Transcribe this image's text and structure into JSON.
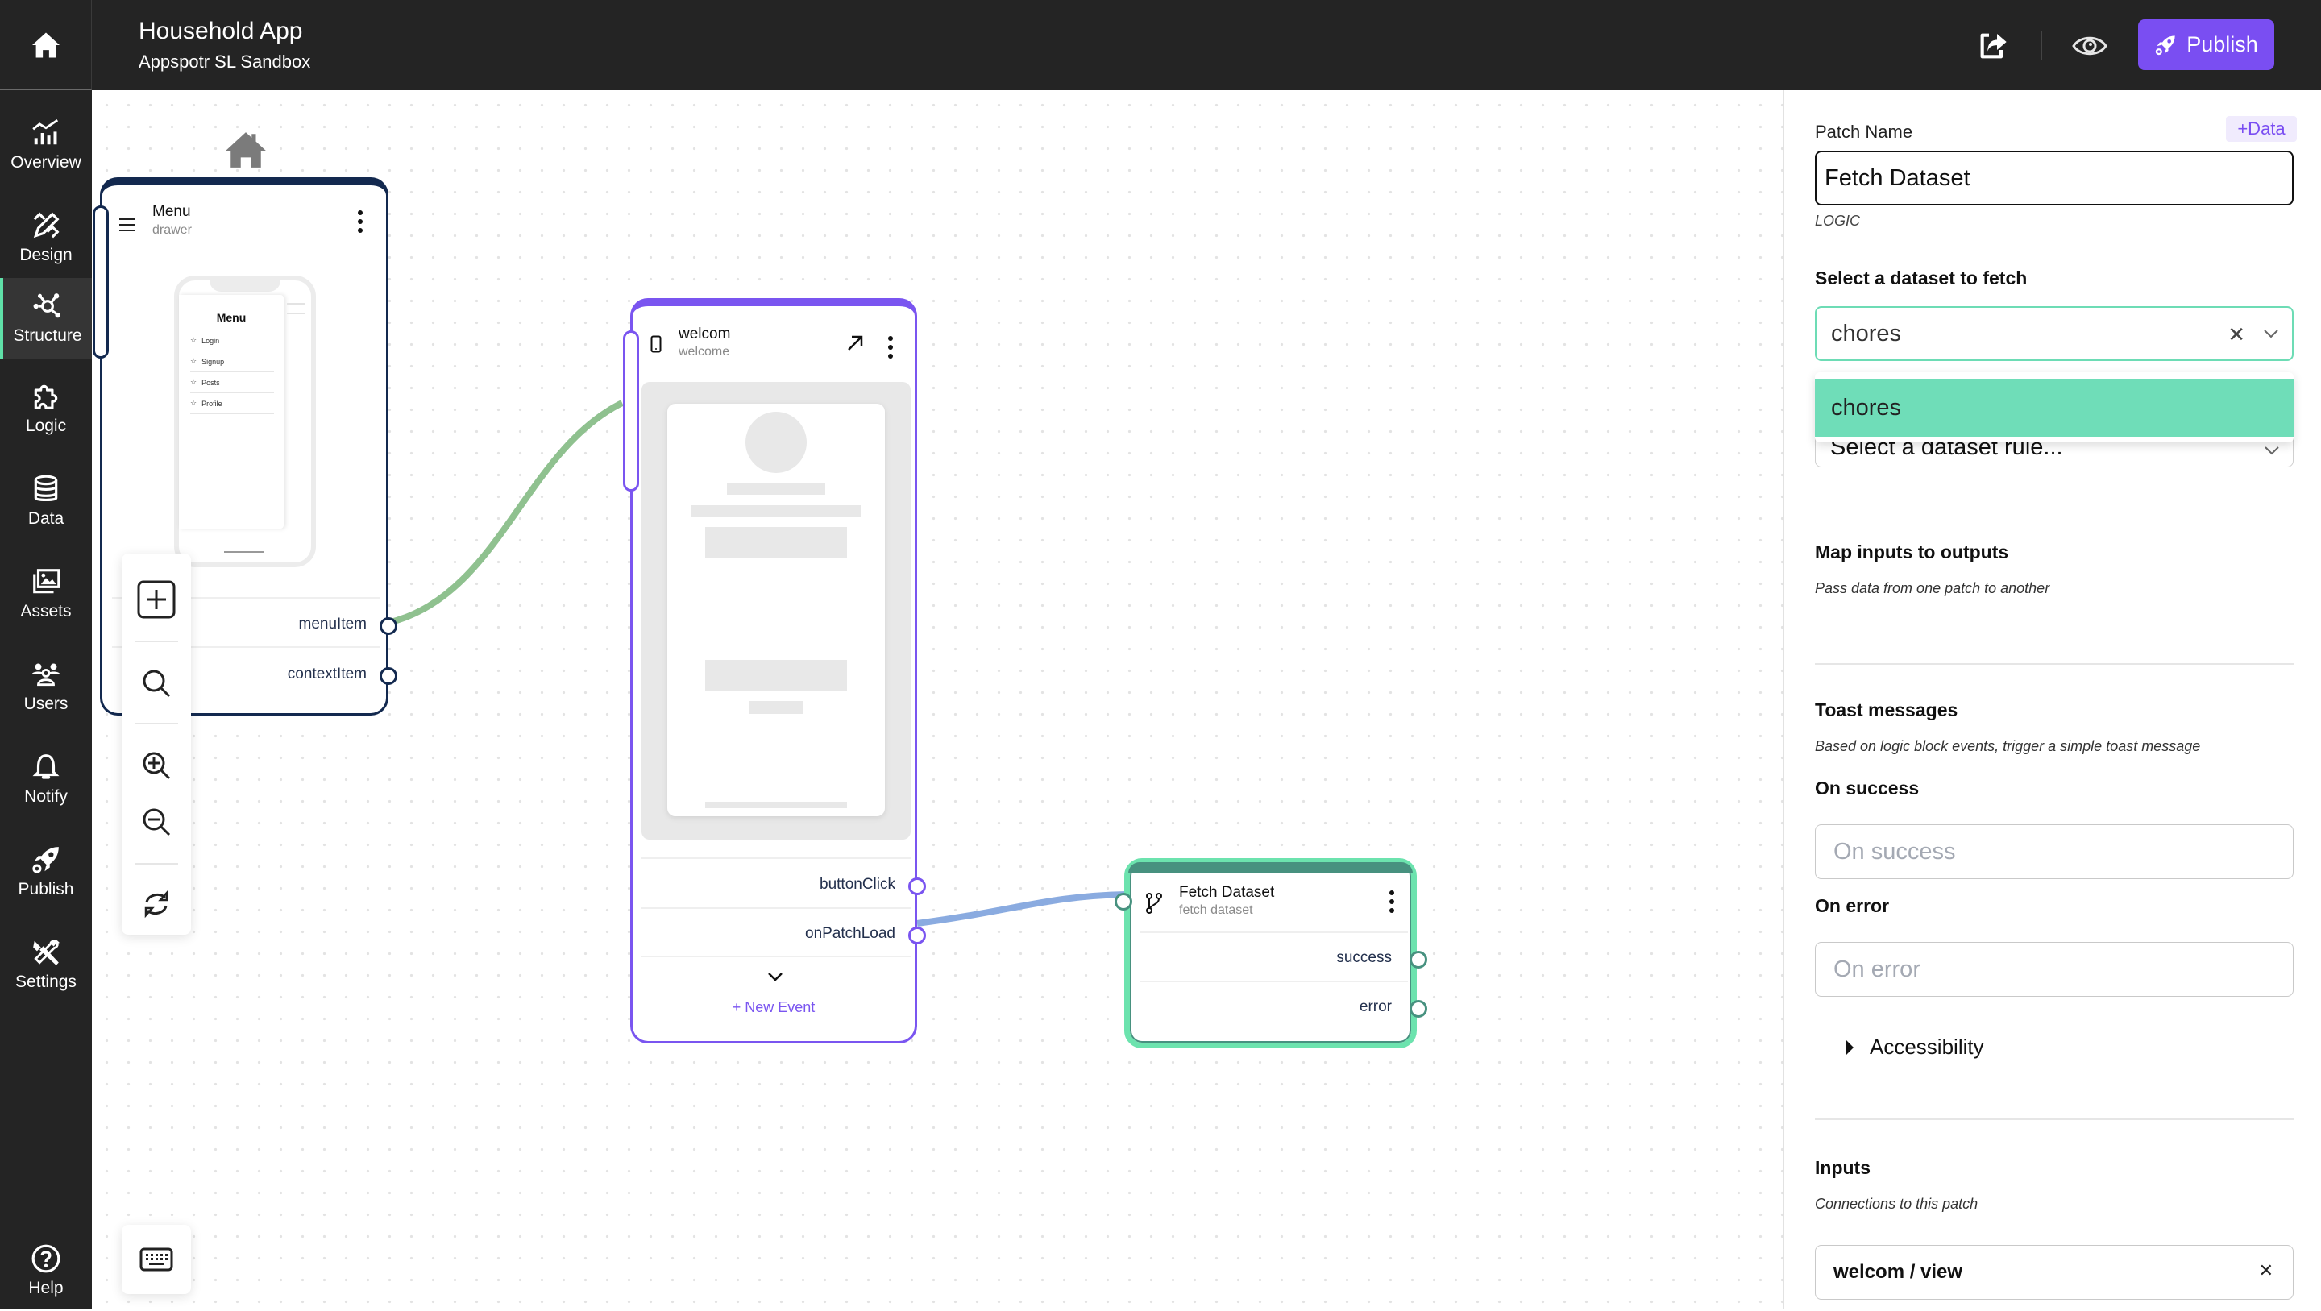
{
  "header": {
    "app_title": "Household App",
    "app_subtitle": "Appspotr SL Sandbox",
    "publish_label": "Publish",
    "icons": {
      "home": "home-icon",
      "share": "share-icon",
      "preview": "eye-icon",
      "publish": "rocket-icon"
    }
  },
  "sidebar": {
    "items": [
      {
        "label": "Overview",
        "icon": "chart-icon",
        "active": false
      },
      {
        "label": "Design",
        "icon": "design-tools-icon",
        "active": false
      },
      {
        "label": "Structure",
        "icon": "structure-icon",
        "active": true
      },
      {
        "label": "Logic",
        "icon": "puzzle-icon",
        "active": false
      },
      {
        "label": "Data",
        "icon": "database-icon",
        "active": false
      },
      {
        "label": "Assets",
        "icon": "images-icon",
        "active": false
      },
      {
        "label": "Users",
        "icon": "users-icon",
        "active": false
      },
      {
        "label": "Notify",
        "icon": "bell-icon",
        "active": false
      },
      {
        "label": "Publish",
        "icon": "rocket-icon",
        "active": false
      },
      {
        "label": "Settings",
        "icon": "tools-icon",
        "active": false
      }
    ],
    "help_label": "Help",
    "accent_color": "#5fe0a8"
  },
  "canvas": {
    "nodes": {
      "menu": {
        "title": "Menu",
        "subtitle": "drawer",
        "preview_title": "Menu",
        "preview_items": [
          "Login",
          "Signup",
          "Posts",
          "Profile"
        ],
        "ports": [
          "menuItem",
          "contextItem"
        ],
        "color": "#13294f"
      },
      "welcome": {
        "title": "welcom",
        "subtitle": "welcome",
        "ports": [
          "buttonClick",
          "onPatchLoad"
        ],
        "new_event_label": "+ New Event",
        "color": "#7a55f0"
      },
      "fetch": {
        "title": "Fetch Dataset",
        "subtitle": "fetch dataset",
        "ports": [
          "success",
          "error"
        ],
        "color": "#6ce3ae",
        "header_color": "#47917f"
      }
    },
    "connections": [
      {
        "from": "menu.menuItem",
        "to": "welcome",
        "color": "#8fc18f"
      },
      {
        "from": "welcome.onPatchLoad",
        "to": "fetch",
        "color": "#8aabe0"
      }
    ],
    "toolbar": [
      "add-icon",
      "search-icon",
      "zoom-in-icon",
      "zoom-out-icon",
      "refresh-icon"
    ],
    "keyboard_icon": "keyboard-icon"
  },
  "panel": {
    "patch_name_label": "Patch Name",
    "add_data_label": "+Data",
    "patch_name_value": "Fetch Dataset",
    "patch_type": "LOGIC",
    "dataset_heading": "Select a dataset to fetch",
    "dataset_value": "chores",
    "dropdown_options": [
      "chores"
    ],
    "rule_placeholder": "Select a dataset rule...",
    "map_heading": "Map inputs to outputs",
    "map_sub": "Pass data from one patch to another",
    "toast_heading": "Toast messages",
    "toast_sub": "Based on logic block events, trigger a simple toast message",
    "on_success_label": "On success",
    "on_success_placeholder": "On success",
    "on_error_label": "On error",
    "on_error_placeholder": "On error",
    "accessibility_label": "Accessibility",
    "inputs_heading": "Inputs",
    "inputs_sub": "Connections to this patch",
    "inputs": [
      {
        "label": "welcom / view"
      }
    ],
    "accent_color": "#6ddcb5"
  }
}
